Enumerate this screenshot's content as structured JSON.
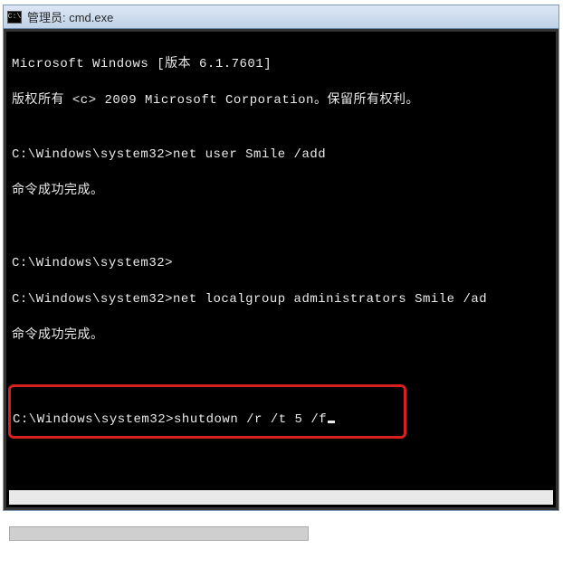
{
  "titlebar": {
    "iconLabel": "C:\\",
    "title": "管理员: cmd.exe"
  },
  "terminal": {
    "line1": "Microsoft Windows [版本 6.1.7601]",
    "line2": "版权所有 <c> 2009 Microsoft Corporation。保留所有权利。",
    "blankA": "",
    "prompt1": "C:\\Windows\\system32>net user Smile /add",
    "result1": "命令成功完成。",
    "blankB": "",
    "blankC": "",
    "prompt2": "C:\\Windows\\system32>",
    "prompt3": "C:\\Windows\\system32>net localgroup administrators Smile /ad",
    "result2": "命令成功完成。",
    "blankD": "",
    "highlightedPrompt": "C:\\Windows\\system32>shutdown /r /t 5 /f"
  }
}
